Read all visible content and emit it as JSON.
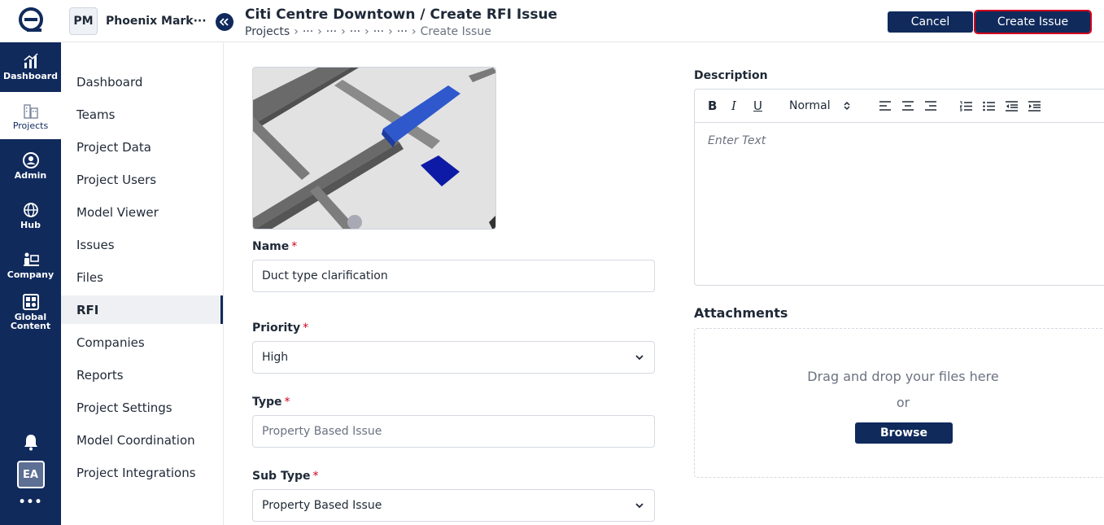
{
  "rail": {
    "items": [
      {
        "label": "Dashboard",
        "icon": "bar-chart-icon"
      },
      {
        "label": "Projects",
        "icon": "buildings-icon"
      },
      {
        "label": "Admin",
        "icon": "admin-gear-icon"
      },
      {
        "label": "Hub",
        "icon": "hub-globe-icon"
      },
      {
        "label": "Company",
        "icon": "company-icon"
      },
      {
        "label": "Global Content",
        "icon": "global-content-icon"
      }
    ],
    "avatar": "EA",
    "more": "•••"
  },
  "project": {
    "badge": "PM",
    "name": "Phoenix Mark···"
  },
  "sidebar": {
    "items": [
      {
        "label": "Dashboard"
      },
      {
        "label": "Teams"
      },
      {
        "label": "Project Data"
      },
      {
        "label": "Project Users"
      },
      {
        "label": "Model Viewer"
      },
      {
        "label": "Issues"
      },
      {
        "label": "Files"
      },
      {
        "label": "RFI"
      },
      {
        "label": "Companies"
      },
      {
        "label": "Reports"
      },
      {
        "label": "Project Settings"
      },
      {
        "label": "Model Coordination"
      },
      {
        "label": "Project Integrations"
      }
    ],
    "active_index": 7
  },
  "header": {
    "title": "Citi Centre Downtown / Create RFI Issue",
    "breadcrumb": [
      "Projects",
      "···",
      "···",
      "···",
      "···",
      "···",
      "Create Issue"
    ],
    "cancel_label": "Cancel",
    "create_label": "Create Issue"
  },
  "form": {
    "name": {
      "label": "Name",
      "value": "Duct type clarification"
    },
    "priority": {
      "label": "Priority",
      "value": "High"
    },
    "type": {
      "label": "Type",
      "placeholder": "Property Based Issue"
    },
    "sub_type": {
      "label": "Sub Type",
      "value": "Property Based Issue"
    }
  },
  "description": {
    "label": "Description",
    "format": "Normal",
    "placeholder": "Enter Text"
  },
  "attachments": {
    "label": "Attachments",
    "drop_text": "Drag and drop your files here",
    "or_text": "or",
    "browse_label": "Browse"
  },
  "colors": {
    "navy": "#102a5c",
    "required": "#d0021b",
    "highlight": "#d0021b"
  }
}
